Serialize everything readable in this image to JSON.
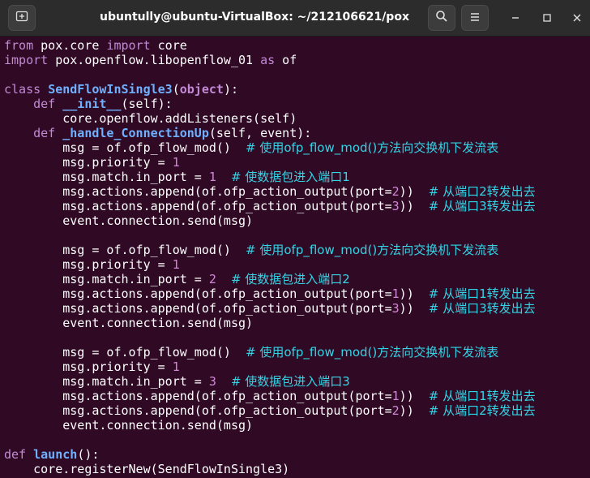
{
  "window": {
    "title": "ubuntully@ubuntu-VirtualBox: ~/212106621/pox",
    "icons": [
      "new-tab-icon",
      "search-icon",
      "hamburger-menu-icon",
      "minimize-icon",
      "maximize-icon",
      "close-icon"
    ]
  },
  "code": {
    "l1": {
      "a": "from",
      "b": " pox.core ",
      "c": "import",
      "d": " core"
    },
    "l2": {
      "a": "import",
      "b": " pox.openflow.libopenflow_01 ",
      "c": "as",
      "d": " of"
    },
    "l4": {
      "a": "class",
      "b": "SendFlowInSingle3",
      "c": "(",
      "d": "object",
      "e": "):"
    },
    "l5": {
      "a": "def",
      "b": "__init__",
      "c": "(self):"
    },
    "l6": {
      "a": "core.openflow.addListeners(self)"
    },
    "l7": {
      "a": "def",
      "b": "_handle_ConnectionUp",
      "c": "(self, event):"
    },
    "blocks": [
      {
        "msg": "msg = of.ofp_flow_mod()",
        "msg_comment": "# 使用ofp_flow_mod()方法向交换机下发流表",
        "priority_prefix": "msg.priority = ",
        "priority": "1",
        "in_port_prefix": "msg.match.in_port = ",
        "in_port": "1",
        "in_port_comment": "# 使数据包进入端口1",
        "a1_prefix": "msg.actions.append(of.ofp_action_output(port=",
        "a1_port": "2",
        "a1_suffix": "))",
        "a1_comment": "# 从端口2转发出去",
        "a2_prefix": "msg.actions.append(of.ofp_action_output(port=",
        "a2_port": "3",
        "a2_suffix": "))",
        "a2_comment": "# 从端口3转发出去",
        "send": "event.connection.send(msg)"
      },
      {
        "msg": "msg = of.ofp_flow_mod()",
        "msg_comment": "# 使用ofp_flow_mod()方法向交换机下发流表",
        "priority_prefix": "msg.priority = ",
        "priority": "1",
        "in_port_prefix": "msg.match.in_port = ",
        "in_port": "2",
        "in_port_comment": "# 使数据包进入端口2",
        "a1_prefix": "msg.actions.append(of.ofp_action_output(port=",
        "a1_port": "1",
        "a1_suffix": "))",
        "a1_comment": "# 从端口1转发出去",
        "a2_prefix": "msg.actions.append(of.ofp_action_output(port=",
        "a2_port": "3",
        "a2_suffix": "))",
        "a2_comment": "# 从端口3转发出去",
        "send": "event.connection.send(msg)"
      },
      {
        "msg": "msg = of.ofp_flow_mod()",
        "msg_comment": "# 使用ofp_flow_mod()方法向交换机下发流表",
        "priority_prefix": "msg.priority = ",
        "priority": "1",
        "in_port_prefix": "msg.match.in_port = ",
        "in_port": "3",
        "in_port_comment": "# 使数据包进入端口3",
        "a1_prefix": "msg.actions.append(of.ofp_action_output(port=",
        "a1_port": "1",
        "a1_suffix": "))",
        "a1_comment": "# 从端口1转发出去",
        "a2_prefix": "msg.actions.append(of.ofp_action_output(port=",
        "a2_port": "2",
        "a2_suffix": "))",
        "a2_comment": "# 从端口2转发出去",
        "send": "event.connection.send(msg)"
      }
    ],
    "l_launch": {
      "a": "def",
      "b": "launch",
      "c": "():"
    },
    "l_register": {
      "a": "core.registerNew(SendFlowInSingle3)"
    }
  },
  "colors": {
    "terminal_bg": "#300a24",
    "titlebar_bg": "#2c2c2c",
    "keyword": "#c28ad6",
    "name": "#6fb0ff",
    "number": "#d187d6",
    "comment": "#33d4e6",
    "text": "#ffffff"
  }
}
